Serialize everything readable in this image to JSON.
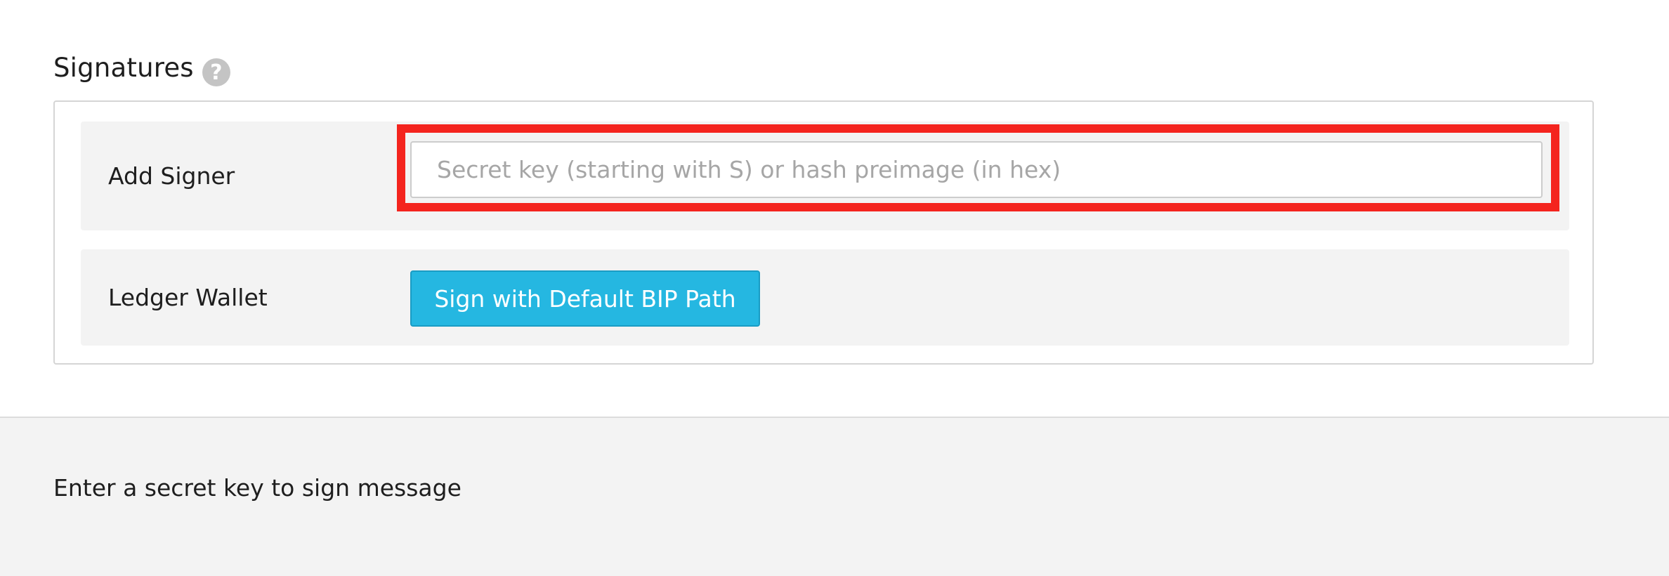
{
  "signatures": {
    "title": "Signatures",
    "help_glyph": "?",
    "help_icon": "question-circle-icon",
    "add_signer": {
      "label": "Add Signer",
      "input_value": "",
      "input_placeholder": "Secret key (starting with S) or hash preimage (in hex)"
    },
    "ledger": {
      "label": "Ledger Wallet",
      "button_label": "Sign with Default BIP Path"
    }
  },
  "footer": {
    "message": "Enter a secret key to sign message"
  },
  "colors": {
    "accent_button": "#25b7e1",
    "highlight_border": "#f4241e",
    "row_background": "#f3f3f3"
  }
}
